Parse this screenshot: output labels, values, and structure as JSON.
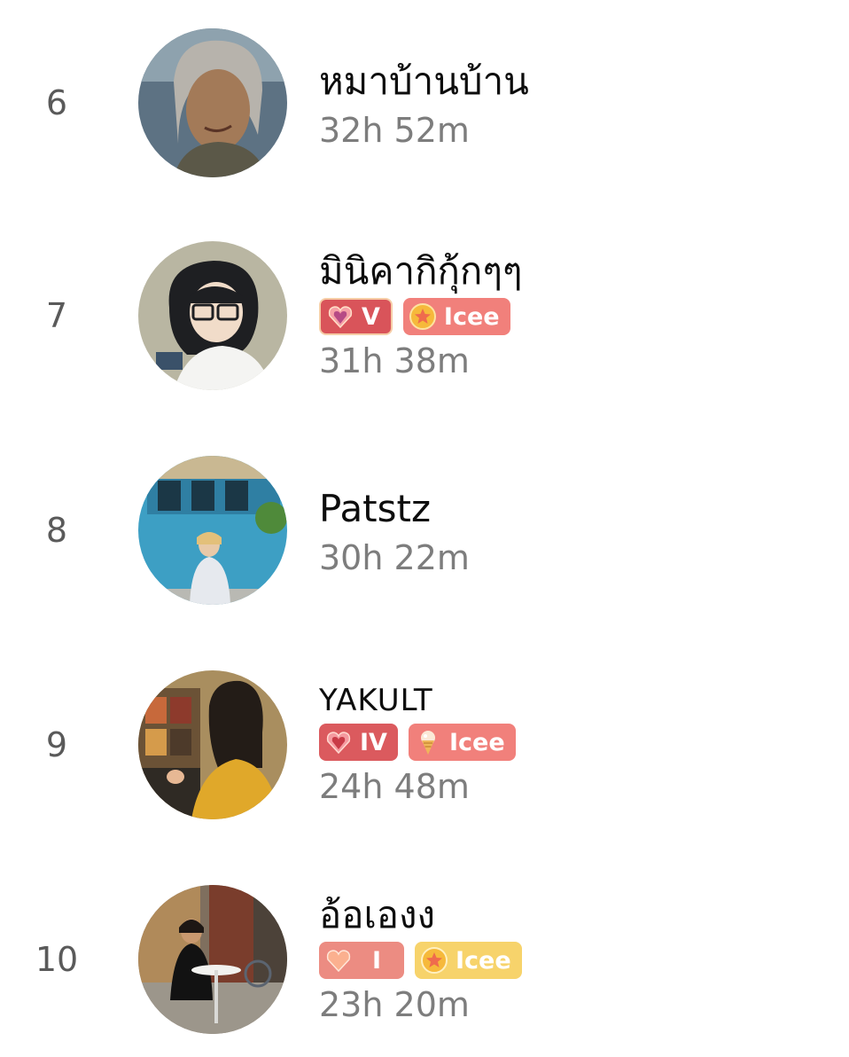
{
  "leaderboard": [
    {
      "rank": "6",
      "name": "หมาบ้านบ้าน",
      "time": "32h 52m",
      "badges": []
    },
    {
      "rank": "7",
      "name": "มินิคากิกุ้กๆๆ",
      "time": "31h 38m",
      "badges": [
        {
          "label": "V",
          "icon": "heart-gem-icon"
        },
        {
          "label": "Icee",
          "icon": "star-medal-icon"
        }
      ]
    },
    {
      "rank": "8",
      "name": "Patstz",
      "time": "30h 22m",
      "badges": []
    },
    {
      "rank": "9",
      "name": "YAKULT",
      "time": "24h 48m",
      "badges": [
        {
          "label": "IV",
          "icon": "heart-gem-icon"
        },
        {
          "label": "Icee",
          "icon": "ice-cream-icon"
        }
      ]
    },
    {
      "rank": "10",
      "name": "อ้อเองง",
      "time": "23h 20m",
      "badges": [
        {
          "label": "I",
          "icon": "heart-icon"
        },
        {
          "label": "Icee",
          "icon": "star-medal-icon"
        }
      ]
    }
  ]
}
